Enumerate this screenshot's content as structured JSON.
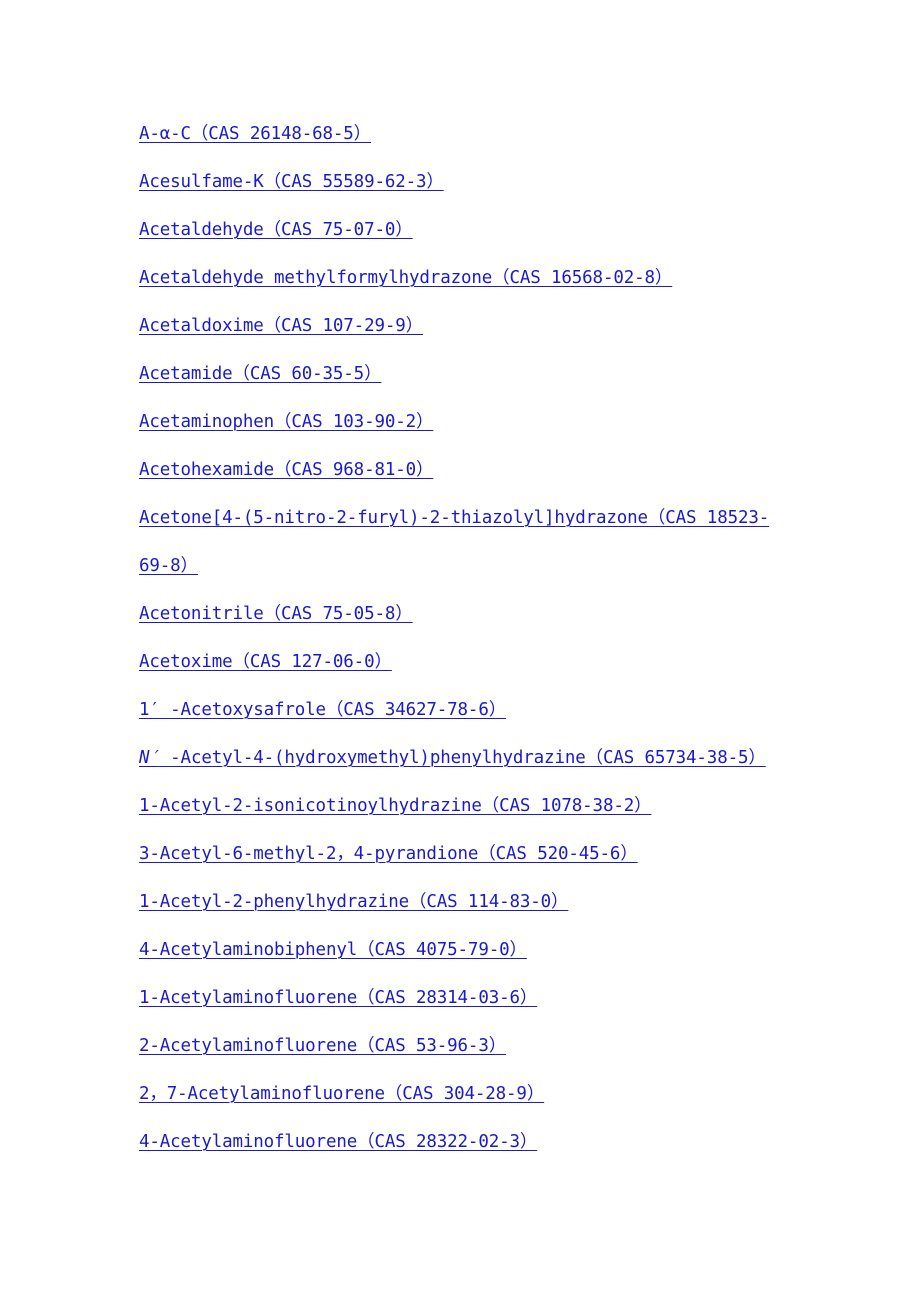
{
  "document": {
    "type": "chemical-index-link-list",
    "link_color": "#1a1aCC",
    "background_color": "#ffffff",
    "entries": [
      {
        "id": "a-alpha-c",
        "text": "A-α-C（CAS 26148-68-5）"
      },
      {
        "id": "acesulfame-k",
        "text": "Acesulfame-K（CAS 55589-62-3）"
      },
      {
        "id": "acetaldehyde",
        "text": "Acetaldehyde（CAS 75-07-0）"
      },
      {
        "id": "acetaldehyde-methylformylhydrazone",
        "text": "Acetaldehyde methylformylhydrazone（CAS 16568-02-8）"
      },
      {
        "id": "acetaldoxime",
        "text": "Acetaldoxime（CAS 107-29-9）"
      },
      {
        "id": "acetamide",
        "text": "Acetamide（CAS 60-35-5）"
      },
      {
        "id": "acetaminophen",
        "text": "Acetaminophen（CAS 103-90-2）"
      },
      {
        "id": "acetohexamide",
        "text": "Acetohexamide（CAS 968-81-0）"
      },
      {
        "id": "acetone-nitrofuryl-thiazolyl-hydrazone",
        "text": "Acetone[4-(5-nitro-2-furyl)-2-thiazolyl]hydrazone（CAS 18523-69-8）"
      },
      {
        "id": "acetonitrile",
        "text": "Acetonitrile（CAS 75-05-8）"
      },
      {
        "id": "acetoxime",
        "text": "Acetoxime（CAS 127-06-0）"
      },
      {
        "id": "1-prime-acetoxysafrole",
        "text": "1′ -Acetoxysafrole（CAS 34627-78-6）"
      },
      {
        "id": "n-prime-acetyl-4-hydroxymethyl-phenylhydrazine",
        "italic_prefix": "N′",
        "text": " -Acetyl-4-(hydroxymethyl)phenylhydrazine（CAS 65734-38-5）"
      },
      {
        "id": "1-acetyl-2-isonicotinoylhydrazine",
        "text": "1-Acetyl-2-isonicotinoylhydrazine（CAS 1078-38-2）"
      },
      {
        "id": "3-acetyl-6-methyl-2-4-pyrandione",
        "text": "3-Acetyl-6-methyl-2，4-pyrandione（CAS 520-45-6）"
      },
      {
        "id": "1-acetyl-2-phenylhydrazine",
        "text": "1-Acetyl-2-phenylhydrazine（CAS 114-83-0）"
      },
      {
        "id": "4-acetylaminobiphenyl",
        "text": "4-Acetylaminobiphenyl（CAS 4075-79-0）"
      },
      {
        "id": "1-acetylaminofluorene",
        "text": "1-Acetylaminofluorene（CAS 28314-03-6）"
      },
      {
        "id": "2-acetylaminofluorene",
        "text": "2-Acetylaminofluorene（CAS 53-96-3）"
      },
      {
        "id": "2-7-acetylaminofluorene",
        "text": "2，7-Acetylaminofluorene（CAS 304-28-9）"
      },
      {
        "id": "4-acetylaminofluorene",
        "text": "4-Acetylaminofluorene（CAS 28322-02-3）"
      }
    ]
  }
}
